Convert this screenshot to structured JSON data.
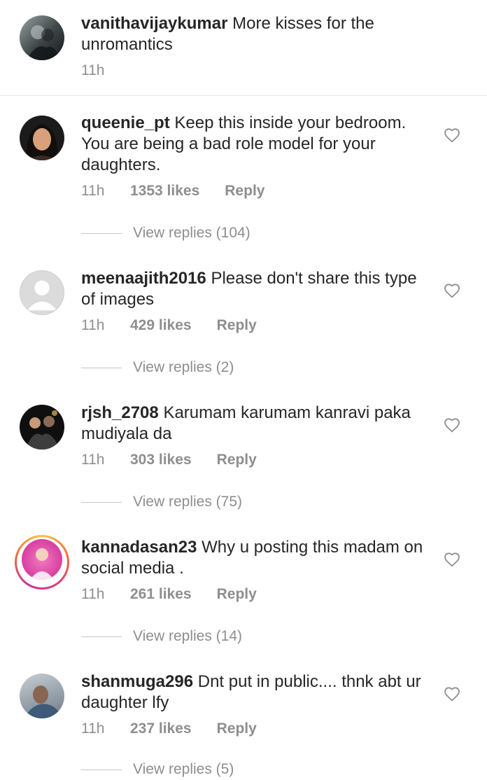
{
  "caption": {
    "username": "vanithavijaykumar",
    "text": "More kisses for the unromantics",
    "time": "11h"
  },
  "comments": [
    {
      "username": "queenie_pt",
      "text": "Keep this inside your bedroom. You are being a bad role model for your daughters.",
      "time": "11h",
      "likes": "1353 likes",
      "reply": "Reply",
      "view_replies": "View replies (104)"
    },
    {
      "username": "meenaajith2016",
      "text": "Please don't share this type of images",
      "time": "11h",
      "likes": "429 likes",
      "reply": "Reply",
      "view_replies": "View replies (2)"
    },
    {
      "username": "rjsh_2708",
      "text": "Karumam karumam kanravi paka mudiyala da",
      "time": "11h",
      "likes": "303 likes",
      "reply": "Reply",
      "view_replies": "View replies (75)"
    },
    {
      "username": "kannadasan23",
      "text": "Why u posting this madam on social media .",
      "time": "11h",
      "likes": "261 likes",
      "reply": "Reply",
      "view_replies": "View replies (14)"
    },
    {
      "username": "shanmuga296",
      "text": "Dnt put in public.... thnk abt ur daughter lfy",
      "time": "11h",
      "likes": "237 likes",
      "reply": "Reply",
      "view_replies": "View replies (5)"
    }
  ],
  "icons": {
    "like": "heart-icon",
    "default_avatar": "person-icon"
  },
  "colors": {
    "text": "#262626",
    "muted": "#8e8e8e",
    "divider": "#e6e6e6"
  }
}
